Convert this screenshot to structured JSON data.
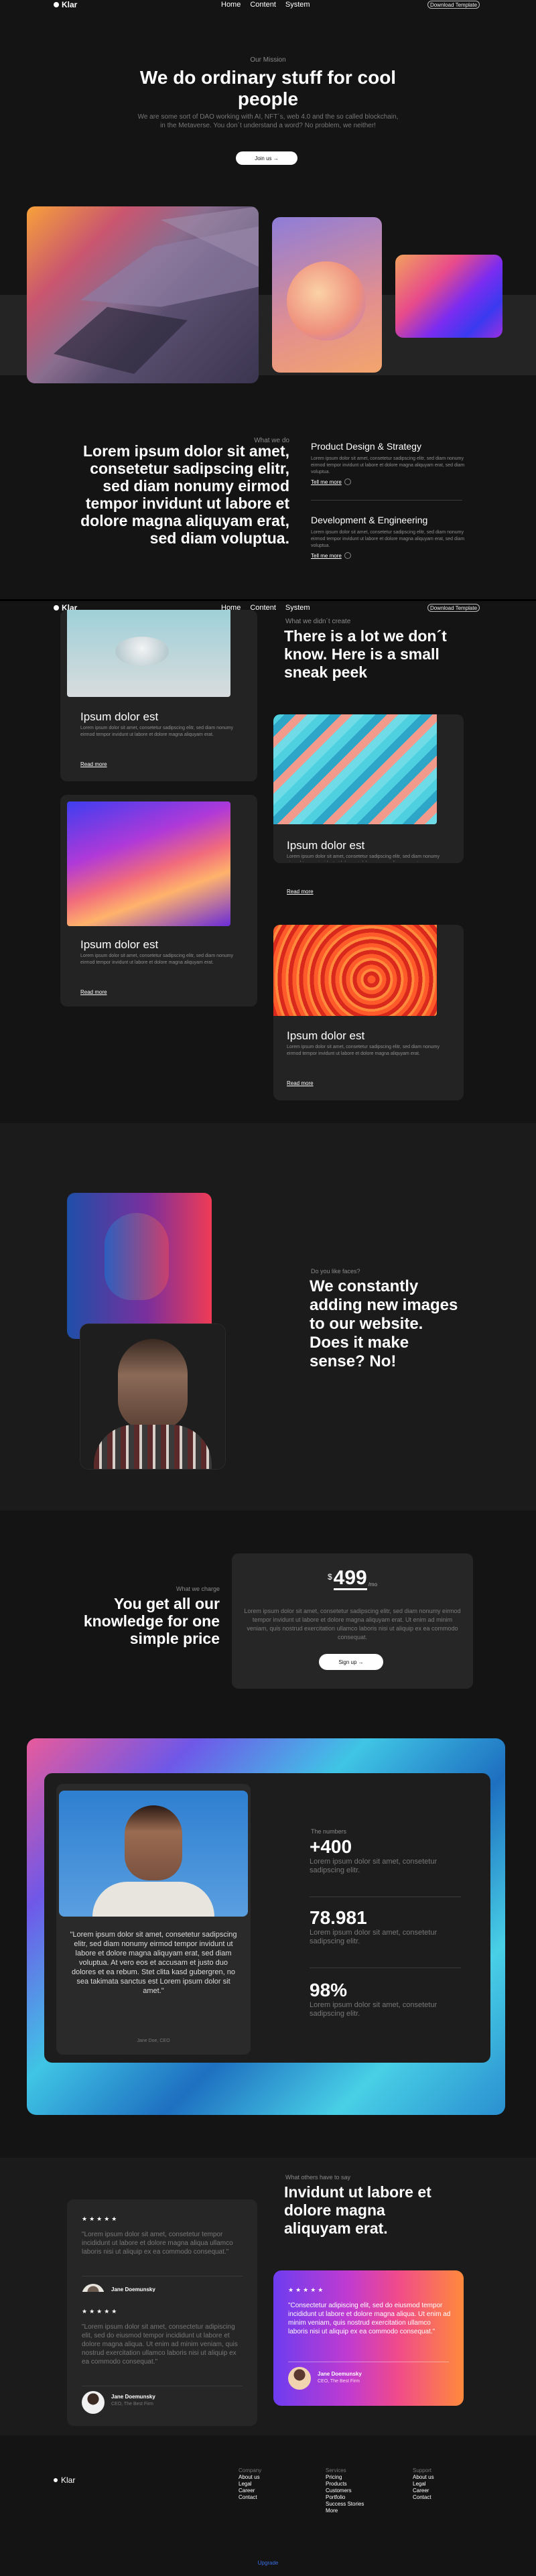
{
  "nav": {
    "logo": "Klar",
    "links": [
      "Home",
      "Content",
      "System"
    ],
    "download": "Download Template"
  },
  "hero": {
    "eyebrow": "Our Mission",
    "title": "We do ordinary stuff for cool people",
    "subtitle": "We are some sort of DAO working with AI, NFT´s, web 4.0 and the so called blockchain, in the Metaverse. You don´t understand a word? No problem, we neither!",
    "button": "Join us →"
  },
  "services": {
    "eyebrow": "What we do",
    "heading": "Lorem ipsum dolor sit amet, consetetur sadipscing elitr, sed diam nonumy eirmod tempor invidunt ut labore et dolore magna aliquyam erat, sed diam voluptua.",
    "items": [
      {
        "title": "Product Design & Strategy",
        "text": "Lorem ipsum dolor sit amet, consetetur sadipscing elitr, sed diam nonumy eirmod tempor invidunt ut labore et dolore magna aliquyam erat, sed diam voluptua.",
        "link": "Tell me more"
      },
      {
        "title": "Development & Engineering",
        "text": "Lorem ipsum dolor sit amet, consetetur sadipscing elitr, sed diam nonumy eirmod tempor invidunt ut labore et dolore magna aliquyam erat, sed diam voluptua.",
        "link": "Tell me more"
      }
    ]
  },
  "sneak": {
    "eyebrow": "What we didn´t create",
    "heading": "There is a lot we don´t know. Here is a small sneak peek",
    "cards": [
      {
        "title": "Ipsum dolor est",
        "text": "Lorem ipsum dolor sit amet, consetetur sadipscing elitr, sed diam nonumy eirmod tempor invidunt ut labore et dolore magna aliquyam erat.",
        "link": "Read more"
      },
      {
        "title": "Ipsum dolor est",
        "text": "Lorem ipsum dolor sit amet, consetetur sadipscing elitr, sed diam nonumy eirmod tempor invidunt ut labore et dolore magna aliquyam erat.",
        "link": "Read more"
      },
      {
        "title": "Ipsum dolor est",
        "text": "Lorem ipsum dolor sit amet, consetetur sadipscing elitr, sed diam nonumy eirmod tempor invidunt ut labore et dolore magna aliquyam erat.",
        "link": "Read more"
      },
      {
        "title": "Ipsum dolor est",
        "text": "Lorem ipsum dolor sit amet, consetetur sadipscing elitr, sed diam nonumy eirmod tempor invidunt ut labore et dolore magna aliquyam erat.",
        "link": "Read more"
      }
    ]
  },
  "images": {
    "eyebrow": "Do you like faces?",
    "heading": "We constantly adding new images to our website. Does it make sense? No!"
  },
  "pricing": {
    "eyebrow": "What we charge",
    "heading": "You get all our knowledge for one simple price",
    "currency": "$",
    "price": "499",
    "period": "/mo",
    "text": "Lorem ipsum dolor sit amet, consetetur sadipscing elitr, sed diam nonumy eirmod tempor invidunt ut labore et dolore magna aliquyam erat. Ut enim ad minim veniam, quis nostrud exercitation ullamco laboris nisi ut aliquip ex ea commodo consequat.",
    "button": "Sign up →"
  },
  "stats": {
    "quote": "\"Lorem ipsum dolor sit amet, consetetur sadipscing elitr, sed diam nonumy eirmod tempor invidunt ut labore et dolore magna aliquyam erat, sed diam voluptua. At vero eos et accusam et justo duo dolores et ea rebum. Stet clita kasd gubergren, no sea takimata sanctus est Lorem ipsum dolor sit amet.\"",
    "author": "Jane Doe, CEO",
    "eyebrow": "The numbers",
    "items": [
      {
        "value": "+400",
        "text": "Lorem ipsum dolor sit amet, consetetur sadipscing elitr."
      },
      {
        "value": "78.981",
        "text": "Lorem ipsum dolor sit amet, consetetur sadipscing elitr."
      },
      {
        "value": "98%",
        "text": "Lorem ipsum dolor sit amet, consetetur sadipscing elitr."
      }
    ]
  },
  "testimonials": {
    "eyebrow": "What others have to say",
    "heading": "Invidunt ut labore et dolore magna aliquyam erat.",
    "stars": "★★★★★",
    "items": [
      {
        "quote": "\"Lorem ipsum dolor sit amet, consetetur tempor incididunt ut labore et dolore magna aliqua ullamco laboris nisi ut aliquip ex ea commodo consequat.\"",
        "name": "Jane Doemunsky",
        "role": "CEO, The Best Firm"
      },
      {
        "quote": "\"Lorem ipsum dolor sit amet, consectetur adipiscing elit, sed do eiusmod tempor incididunt ut labore et dolore magna aliqua. Ut enim ad minim veniam, quis nostrud exercitation ullamco laboris nisi ut aliquip ex ea commodo consequat.\"",
        "name": "Jane Doemunsky",
        "role": "CEO, The Best Firm"
      },
      {
        "quote": "\"Consectetur adipiscing elit, sed do eiusmod tempor incididunt ut labore et dolore magna aliqua. Ut enim ad minim veniam, quis nostrud exercitation ullamco laboris nisi ut aliquip ex ea commodo consequat.\"",
        "name": "Jane Doemunsky",
        "role": "CEO, The Best Firm"
      }
    ]
  },
  "footer": {
    "logo": "Klar",
    "columns": [
      {
        "title": "Company",
        "links": [
          "About us",
          "Legal",
          "Career",
          "Contact"
        ]
      },
      {
        "title": "Services",
        "links": [
          "Pricing",
          "Products",
          "Customers",
          "Portfolio",
          "Success Stories",
          "More"
        ]
      },
      {
        "title": "Support",
        "links": [
          "About us",
          "Legal",
          "Career",
          "Contact"
        ]
      }
    ],
    "bottom_link": "Upgrade"
  }
}
